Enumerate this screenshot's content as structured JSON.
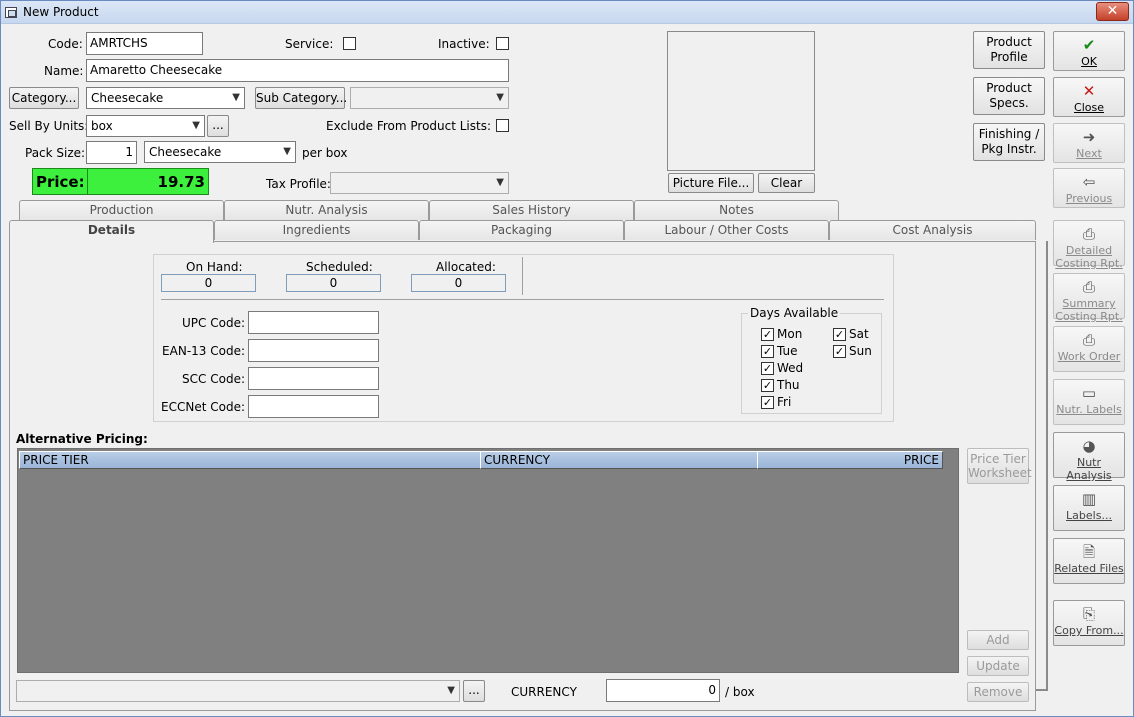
{
  "window": {
    "title": "New Product",
    "close_glyph": "✕"
  },
  "form": {
    "code_label": "Code:",
    "code_value": "AMRTCHS",
    "service_label": "Service:",
    "inactive_label": "Inactive:",
    "name_label": "Name:",
    "name_value": "Amaretto Cheesecake",
    "category_button": "Category...",
    "category_value": "Cheesecake",
    "subcategory_button": "Sub Category...",
    "subcategory_value": "",
    "sell_by_units_label": "Sell By Units:",
    "sell_by_units_value": "box",
    "sell_by_ellipsis": "...",
    "exclude_label": "Exclude From Product Lists:",
    "pack_size_label": "Pack Size:",
    "pack_size_value": "1",
    "pack_size_unit": "Cheesecake",
    "per_label": "per box",
    "price_label": "Price:",
    "price_value": "19.73",
    "tax_profile_label": "Tax Profile:",
    "tax_profile_value": ""
  },
  "picture": {
    "picture_file_button": "Picture File...",
    "clear_button": "Clear"
  },
  "side_buttons": {
    "product_profile": "Product Profile",
    "product_specs": "Product Specs.",
    "finishing": "Finishing / Pkg Instr.",
    "ok": "OK",
    "close": "Close",
    "next": "Next",
    "previous": "Previous"
  },
  "right_toolbar": [
    {
      "label": "Detailed Costing Rpt.",
      "icon": "report-icon"
    },
    {
      "label": "Summary Costing Rpt.",
      "icon": "report-icon"
    },
    {
      "label": "Work Order",
      "icon": "work-order-icon"
    },
    {
      "label": "Nutr. Labels",
      "icon": "nutrition-label-icon"
    },
    {
      "label": "Nutr Analysis",
      "icon": "pie-chart-icon"
    },
    {
      "label": "Labels...",
      "icon": "barcode-icon"
    },
    {
      "label": "Related Files",
      "icon": "files-icon"
    },
    {
      "label": "Copy From...",
      "icon": "copy-icon"
    }
  ],
  "tabs_back": [
    "Production",
    "Nutr. Analysis",
    "Sales History",
    "Notes"
  ],
  "tabs_front": [
    "Details",
    "Ingredients",
    "Packaging",
    "Labour / Other Costs",
    "Cost Analysis"
  ],
  "details": {
    "on_hand_label": "On Hand:",
    "on_hand_value": "0",
    "scheduled_label": "Scheduled:",
    "scheduled_value": "0",
    "allocated_label": "Allocated:",
    "allocated_value": "0",
    "upc_label": "UPC Code:",
    "ean_label": "EAN-13 Code:",
    "scc_label": "SCC Code:",
    "eccnet_label": "ECCNet Code:",
    "days_title": "Days Available",
    "days": [
      {
        "label": "Mon",
        "checked": true
      },
      {
        "label": "Tue",
        "checked": true
      },
      {
        "label": "Wed",
        "checked": true
      },
      {
        "label": "Thu",
        "checked": true
      },
      {
        "label": "Fri",
        "checked": true
      },
      {
        "label": "Sat",
        "checked": true
      },
      {
        "label": "Sun",
        "checked": true
      }
    ]
  },
  "alt_pricing": {
    "title": "Alternative Pricing:",
    "columns": [
      "PRICE TIER",
      "CURRENCY",
      "PRICE"
    ],
    "worksheet_button": "Price Tier Worksheet",
    "add_button": "Add",
    "update_button": "Update",
    "remove_button": "Remove",
    "currency_label": "CURRENCY",
    "price_value": "0",
    "per_unit": "/ box",
    "ellipsis": "..."
  }
}
